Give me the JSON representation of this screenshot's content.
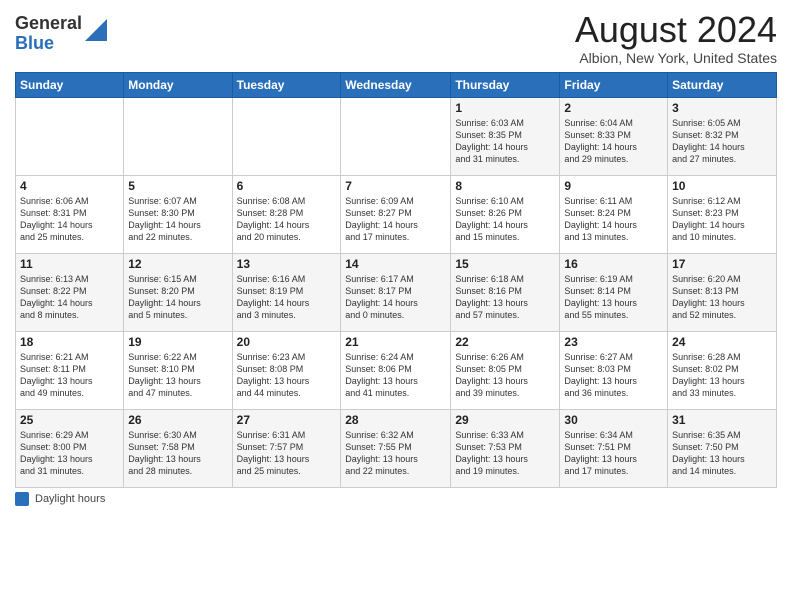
{
  "header": {
    "logo_general": "General",
    "logo_blue": "Blue",
    "month_title": "August 2024",
    "location": "Albion, New York, United States"
  },
  "weekdays": [
    "Sunday",
    "Monday",
    "Tuesday",
    "Wednesday",
    "Thursday",
    "Friday",
    "Saturday"
  ],
  "footer": {
    "daylight_label": "Daylight hours"
  },
  "weeks": [
    [
      {
        "day": "",
        "info": ""
      },
      {
        "day": "",
        "info": ""
      },
      {
        "day": "",
        "info": ""
      },
      {
        "day": "",
        "info": ""
      },
      {
        "day": "1",
        "info": "Sunrise: 6:03 AM\nSunset: 8:35 PM\nDaylight: 14 hours\nand 31 minutes."
      },
      {
        "day": "2",
        "info": "Sunrise: 6:04 AM\nSunset: 8:33 PM\nDaylight: 14 hours\nand 29 minutes."
      },
      {
        "day": "3",
        "info": "Sunrise: 6:05 AM\nSunset: 8:32 PM\nDaylight: 14 hours\nand 27 minutes."
      }
    ],
    [
      {
        "day": "4",
        "info": "Sunrise: 6:06 AM\nSunset: 8:31 PM\nDaylight: 14 hours\nand 25 minutes."
      },
      {
        "day": "5",
        "info": "Sunrise: 6:07 AM\nSunset: 8:30 PM\nDaylight: 14 hours\nand 22 minutes."
      },
      {
        "day": "6",
        "info": "Sunrise: 6:08 AM\nSunset: 8:28 PM\nDaylight: 14 hours\nand 20 minutes."
      },
      {
        "day": "7",
        "info": "Sunrise: 6:09 AM\nSunset: 8:27 PM\nDaylight: 14 hours\nand 17 minutes."
      },
      {
        "day": "8",
        "info": "Sunrise: 6:10 AM\nSunset: 8:26 PM\nDaylight: 14 hours\nand 15 minutes."
      },
      {
        "day": "9",
        "info": "Sunrise: 6:11 AM\nSunset: 8:24 PM\nDaylight: 14 hours\nand 13 minutes."
      },
      {
        "day": "10",
        "info": "Sunrise: 6:12 AM\nSunset: 8:23 PM\nDaylight: 14 hours\nand 10 minutes."
      }
    ],
    [
      {
        "day": "11",
        "info": "Sunrise: 6:13 AM\nSunset: 8:22 PM\nDaylight: 14 hours\nand 8 minutes."
      },
      {
        "day": "12",
        "info": "Sunrise: 6:15 AM\nSunset: 8:20 PM\nDaylight: 14 hours\nand 5 minutes."
      },
      {
        "day": "13",
        "info": "Sunrise: 6:16 AM\nSunset: 8:19 PM\nDaylight: 14 hours\nand 3 minutes."
      },
      {
        "day": "14",
        "info": "Sunrise: 6:17 AM\nSunset: 8:17 PM\nDaylight: 14 hours\nand 0 minutes."
      },
      {
        "day": "15",
        "info": "Sunrise: 6:18 AM\nSunset: 8:16 PM\nDaylight: 13 hours\nand 57 minutes."
      },
      {
        "day": "16",
        "info": "Sunrise: 6:19 AM\nSunset: 8:14 PM\nDaylight: 13 hours\nand 55 minutes."
      },
      {
        "day": "17",
        "info": "Sunrise: 6:20 AM\nSunset: 8:13 PM\nDaylight: 13 hours\nand 52 minutes."
      }
    ],
    [
      {
        "day": "18",
        "info": "Sunrise: 6:21 AM\nSunset: 8:11 PM\nDaylight: 13 hours\nand 49 minutes."
      },
      {
        "day": "19",
        "info": "Sunrise: 6:22 AM\nSunset: 8:10 PM\nDaylight: 13 hours\nand 47 minutes."
      },
      {
        "day": "20",
        "info": "Sunrise: 6:23 AM\nSunset: 8:08 PM\nDaylight: 13 hours\nand 44 minutes."
      },
      {
        "day": "21",
        "info": "Sunrise: 6:24 AM\nSunset: 8:06 PM\nDaylight: 13 hours\nand 41 minutes."
      },
      {
        "day": "22",
        "info": "Sunrise: 6:26 AM\nSunset: 8:05 PM\nDaylight: 13 hours\nand 39 minutes."
      },
      {
        "day": "23",
        "info": "Sunrise: 6:27 AM\nSunset: 8:03 PM\nDaylight: 13 hours\nand 36 minutes."
      },
      {
        "day": "24",
        "info": "Sunrise: 6:28 AM\nSunset: 8:02 PM\nDaylight: 13 hours\nand 33 minutes."
      }
    ],
    [
      {
        "day": "25",
        "info": "Sunrise: 6:29 AM\nSunset: 8:00 PM\nDaylight: 13 hours\nand 31 minutes."
      },
      {
        "day": "26",
        "info": "Sunrise: 6:30 AM\nSunset: 7:58 PM\nDaylight: 13 hours\nand 28 minutes."
      },
      {
        "day": "27",
        "info": "Sunrise: 6:31 AM\nSunset: 7:57 PM\nDaylight: 13 hours\nand 25 minutes."
      },
      {
        "day": "28",
        "info": "Sunrise: 6:32 AM\nSunset: 7:55 PM\nDaylight: 13 hours\nand 22 minutes."
      },
      {
        "day": "29",
        "info": "Sunrise: 6:33 AM\nSunset: 7:53 PM\nDaylight: 13 hours\nand 19 minutes."
      },
      {
        "day": "30",
        "info": "Sunrise: 6:34 AM\nSunset: 7:51 PM\nDaylight: 13 hours\nand 17 minutes."
      },
      {
        "day": "31",
        "info": "Sunrise: 6:35 AM\nSunset: 7:50 PM\nDaylight: 13 hours\nand 14 minutes."
      }
    ]
  ]
}
